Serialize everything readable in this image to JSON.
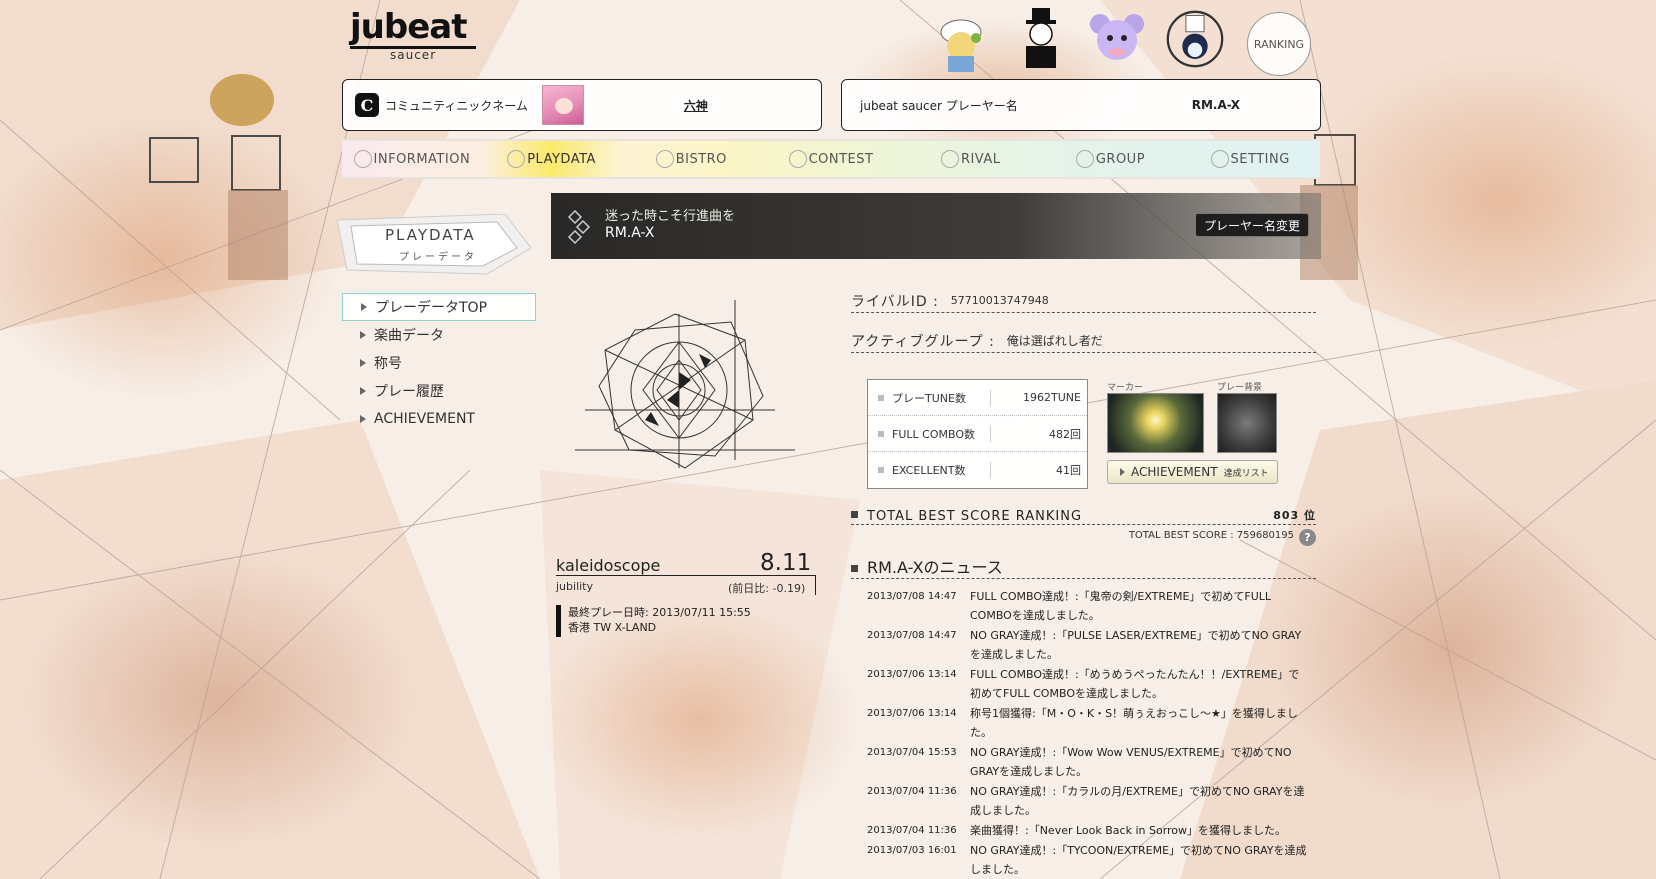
{
  "logo": {
    "brand": "jubeat",
    "sub": "saucer"
  },
  "header": {
    "ranking_label": "RANKING"
  },
  "community": {
    "icon": "community-c-icon",
    "label": "コミュニティニックネーム",
    "nickname": "六神"
  },
  "player": {
    "label": "jubeat saucer プレーヤー名",
    "name": "RM.A-X"
  },
  "nav": {
    "items": [
      {
        "label": "INFORMATION",
        "icon": "information-icon"
      },
      {
        "label": "PLAYDATA",
        "icon": "playdata-icon"
      },
      {
        "label": "BISTRO",
        "icon": "bistro-icon"
      },
      {
        "label": "CONTEST",
        "icon": "contest-icon"
      },
      {
        "label": "RIVAL",
        "icon": "rival-icon"
      },
      {
        "label": "GROUP",
        "icon": "group-icon"
      },
      {
        "label": "SETTING",
        "icon": "setting-icon"
      }
    ],
    "active": "PLAYDATA"
  },
  "badge": {
    "title": "PLAYDATA",
    "subtitle": "プレーデータ"
  },
  "banner": {
    "message": "迷った時こそ行進曲を",
    "name": "RM.A-X",
    "change_name_button": "プレーヤー名変更"
  },
  "sidemenu": {
    "items": [
      "プレーデータTOP",
      "楽曲データ",
      "称号",
      "プレー履歴",
      "ACHIEVEMENT"
    ]
  },
  "profile": {
    "title": "kaleidoscope",
    "jubility_label": "jubility",
    "jubility_value": "8.11",
    "jubility_diff": "(前日比: -0.19)",
    "last_play": "最終プレー日時: 2013/07/11 15:55",
    "location": "香港 TW X-LAND"
  },
  "info": {
    "rival_id_label": "ライバルID :",
    "rival_id": "57710013747948",
    "group_label": "アクティブグループ :",
    "group": "俺は選ばれし者だ"
  },
  "stats": [
    {
      "label": "プレーTUNE数",
      "value": "1962TUNE"
    },
    {
      "label": "FULL COMBO数",
      "value": "482回"
    },
    {
      "label": "EXCELLENT数",
      "value": "41回"
    }
  ],
  "thumbs": {
    "marker_caption": "マーカー",
    "background_caption": "プレー背景"
  },
  "achievement_button": {
    "label": "ACHIEVEMENT",
    "small": "達成リスト"
  },
  "ranking": {
    "title": "TOTAL BEST SCORE RANKING",
    "rank": "803 位",
    "best_score": "TOTAL BEST SCORE : 759680195",
    "help_icon": "?"
  },
  "news": {
    "title": "RM.A-Xのニュース",
    "items": [
      {
        "date": "2013/07/08 14:47",
        "text": "FULL COMBO達成！:「鬼帝の剣/EXTREME」で初めてFULL COMBOを達成しました。"
      },
      {
        "date": "2013/07/08 14:47",
        "text": "NO GRAY達成！:「PULSE LASER/EXTREME」で初めてNO GRAYを達成しました。"
      },
      {
        "date": "2013/07/06 13:14",
        "text": "FULL COMBO達成！:「めうめうぺったんたん！！/EXTREME」で初めてFULL COMBOを達成しました。"
      },
      {
        "date": "2013/07/06 13:14",
        "text": "称号1個獲得:「M・O・K・S！萌ぅえおっこし～★」を獲得しました。"
      },
      {
        "date": "2013/07/04 15:53",
        "text": "NO GRAY達成！:「Wow Wow VENUS/EXTREME」で初めてNO GRAYを達成しました。"
      },
      {
        "date": "2013/07/04 11:36",
        "text": "NO GRAY達成！:「カラルの月/EXTREME」で初めてNO GRAYを達成しました。"
      },
      {
        "date": "2013/07/04 11:36",
        "text": "楽曲獲得！:「Never Look Back in Sorrow」を獲得しました。"
      },
      {
        "date": "2013/07/03 16:01",
        "text": "NO GRAY達成！:「TYCOON/EXTREME」で初めてNO GRAYを達成しました。"
      }
    ]
  }
}
